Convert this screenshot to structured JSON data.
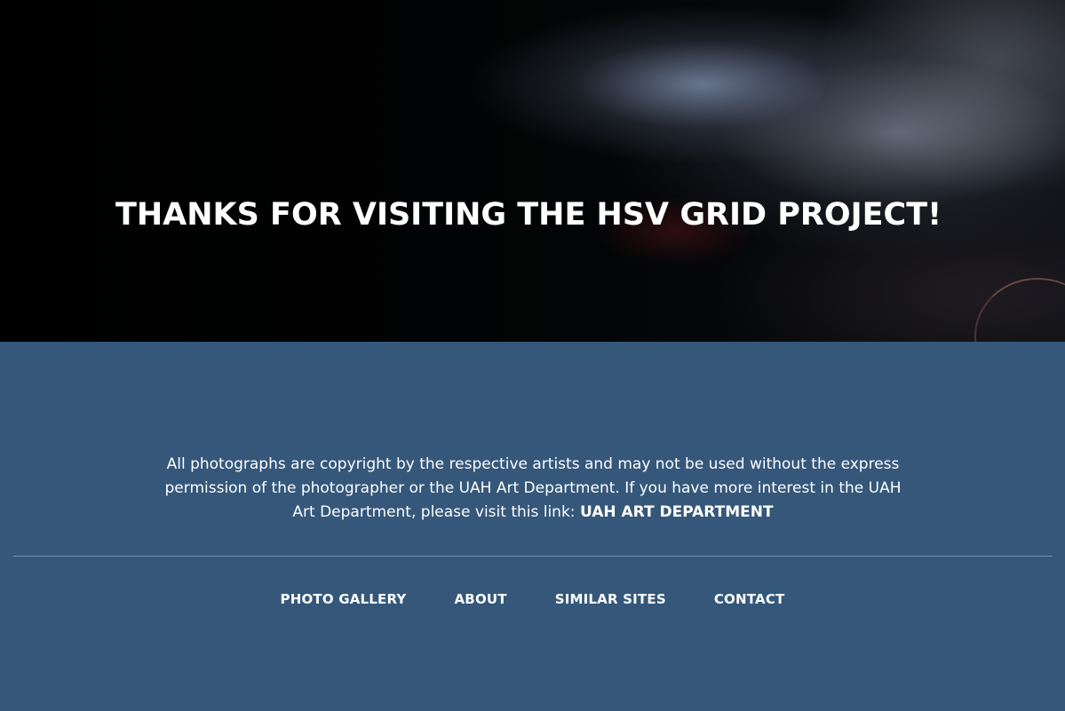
{
  "hero": {
    "title": "THANKS FOR VISITING THE HSV GRID PROJECT!"
  },
  "footer": {
    "copyright_text": "All photographs are copyright by the respective artists and may not be used without the express permission of the photographer or the UAH Art Department. If you have more interest in the UAH Art Department, please visit this link: ",
    "copyright_link": "UAH ART DEPARTMENT",
    "nav": {
      "photo_gallery": "PHOTO GALLERY",
      "about": "ABOUT",
      "similar_sites": "SIMILAR SITES",
      "contact": "CONTACT"
    },
    "colors": {
      "background": "#34577a",
      "hero_background": "#020304",
      "text": "#ffffff"
    }
  }
}
